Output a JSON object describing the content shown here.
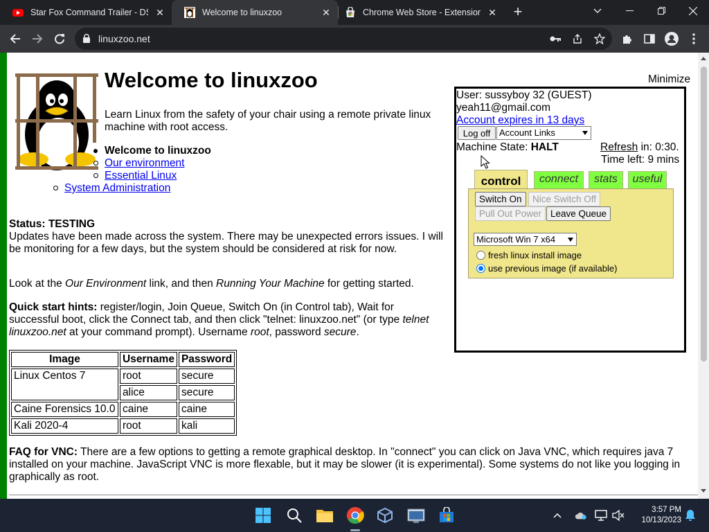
{
  "browser": {
    "tabs": [
      {
        "title": "Star Fox Command Trailer - DS -",
        "favicon": "youtube-icon",
        "active": false
      },
      {
        "title": "Welcome to linuxzoo",
        "favicon": "linuxzoo-icon",
        "active": true
      },
      {
        "title": "Chrome Web Store - Extensions",
        "favicon": "web-store-icon",
        "active": false
      }
    ],
    "url": "linuxzoo.net"
  },
  "page": {
    "title": "Welcome to linuxzoo",
    "intro": "Learn Linux from the safety of your chair using a remote private linux machine with root access.",
    "nav": {
      "current": "Welcome to linuxzoo",
      "our_environment": "Our environment",
      "essential_linux": "Essential Linux",
      "system_administration": "System Administration"
    },
    "status": {
      "label": "Status: TESTING",
      "text": "Updates have been made across the system. There may be unexpected errors issues. I will be monitoring for a few days, but the system should be considered at risk for now."
    },
    "lookat": {
      "pre": "Look at the ",
      "em1": "Our Environment",
      "mid": " link, and then ",
      "em2": "Running Your Machine",
      "post": " for getting started."
    },
    "hints": {
      "label": "Quick start hints:",
      "text1": " register/login, Join Queue, Switch On (in Control tab), Wait for successful boot, click the Connect tab, and then click \"telnet: linuxzoo.net\" (or type ",
      "em1": "telnet linuxzoo.net",
      "text2": " at your command prompt). Username ",
      "em2": "root",
      "text3": ", password ",
      "em3": "secure",
      "text4": "."
    },
    "creds_table": {
      "headers": [
        "Image",
        "Username",
        "Password"
      ],
      "rows": [
        {
          "image": "Linux Centos 7",
          "username": "root",
          "password": "secure"
        },
        {
          "image": "",
          "username": "alice",
          "password": "secure"
        },
        {
          "image": "Caine Forensics 10.0",
          "username": "caine",
          "password": "caine"
        },
        {
          "image": "Kali 2020-4",
          "username": "root",
          "password": "kali"
        }
      ]
    },
    "faq": {
      "label": "FAQ for VNC:",
      "text": " There are a few options to getting a remote graphical desktop. In \"connect\" you can click on Java VNC, which requires java 7 installed on your machine. JavaScript VNC is more flexable, but it may be slower (it is experimental). Some systems do not like you logging in graphically as root."
    }
  },
  "panel": {
    "minimize": "Minimize",
    "user": "User: sussyboy 32 (GUEST)",
    "email": "yeah11@gmail.com",
    "expires": "Account expires in 13 days",
    "logoff": "Log off",
    "account_links": "Account Links",
    "machine_state_label": "Machine State: ",
    "machine_state": "HALT",
    "refresh_link": "Refresh",
    "refresh_in": " in: 0:30.",
    "time_left": "Time left: 9 mins",
    "tabs": [
      "control",
      "connect",
      "stats",
      "useful"
    ],
    "control": {
      "switch_on": "Switch On",
      "nice_switch_off": "Nice Switch Off",
      "pull_out_power": "Pull Out Power",
      "leave_queue": "Leave Queue",
      "os_select": "Microsoft Win 7 x64",
      "radio_fresh": "fresh linux install image",
      "radio_previous": "use previous image (if available)",
      "selected_radio": "previous"
    }
  },
  "taskbar": {
    "time": "3:57 PM",
    "date": "10/13/2023"
  }
}
